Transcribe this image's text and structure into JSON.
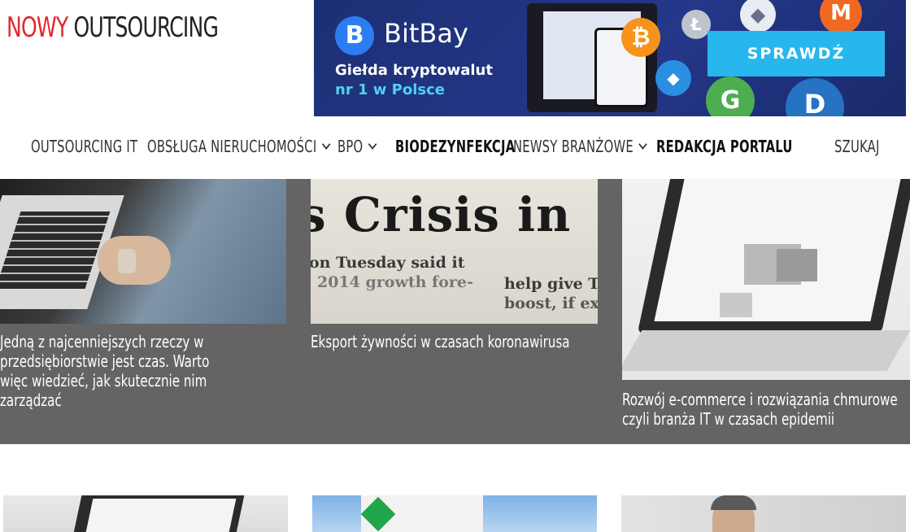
{
  "logo": {
    "part1": "NOWY",
    "part2": "OUTSOURCING"
  },
  "banner": {
    "brand": "BitBay",
    "tagline_line1": "Giełda kryptowalut",
    "tagline_line2": "nr 1 w Polsce",
    "cta": "SPRAWDŹ",
    "accent_color": "#27b7ec",
    "background_color": "#24378a"
  },
  "nav": {
    "items": [
      {
        "label": "OUTSOURCING IT"
      },
      {
        "label": "OBSŁUGA NIERUCHOMOŚCI"
      },
      {
        "label": "BPO"
      },
      {
        "label": "BIODEZYNFEKCJA"
      },
      {
        "label": "NEWSY BRANŻOWE"
      },
      {
        "label": "REDAKCJA PORTALU"
      }
    ],
    "search_label": "SZUKAJ"
  },
  "articles": [
    {
      "title": "Jedną z najcenniejszych rzeczy w przedsiębiorstwie jest czas. Warto więc wiedzieć, jak skutecznie nim zarządzać"
    },
    {
      "title": "Eksport żywności w czasach koronawirusa"
    },
    {
      "title": "Rozwój e-commerce i rozwiązania chmurowe czyli branża IT w czasach epidemii"
    }
  ],
  "image_texts": {
    "newspaper_headline": "s Crisis in",
    "newspaper_line1": "on Tuesday said it",
    "newspaper_line2": "2014 growth fore-",
    "newspaper_line3": "help give T",
    "newspaper_line4": "boost, if ex"
  },
  "colors": {
    "brand_red": "#e3262c",
    "band_grey": "#646464"
  }
}
